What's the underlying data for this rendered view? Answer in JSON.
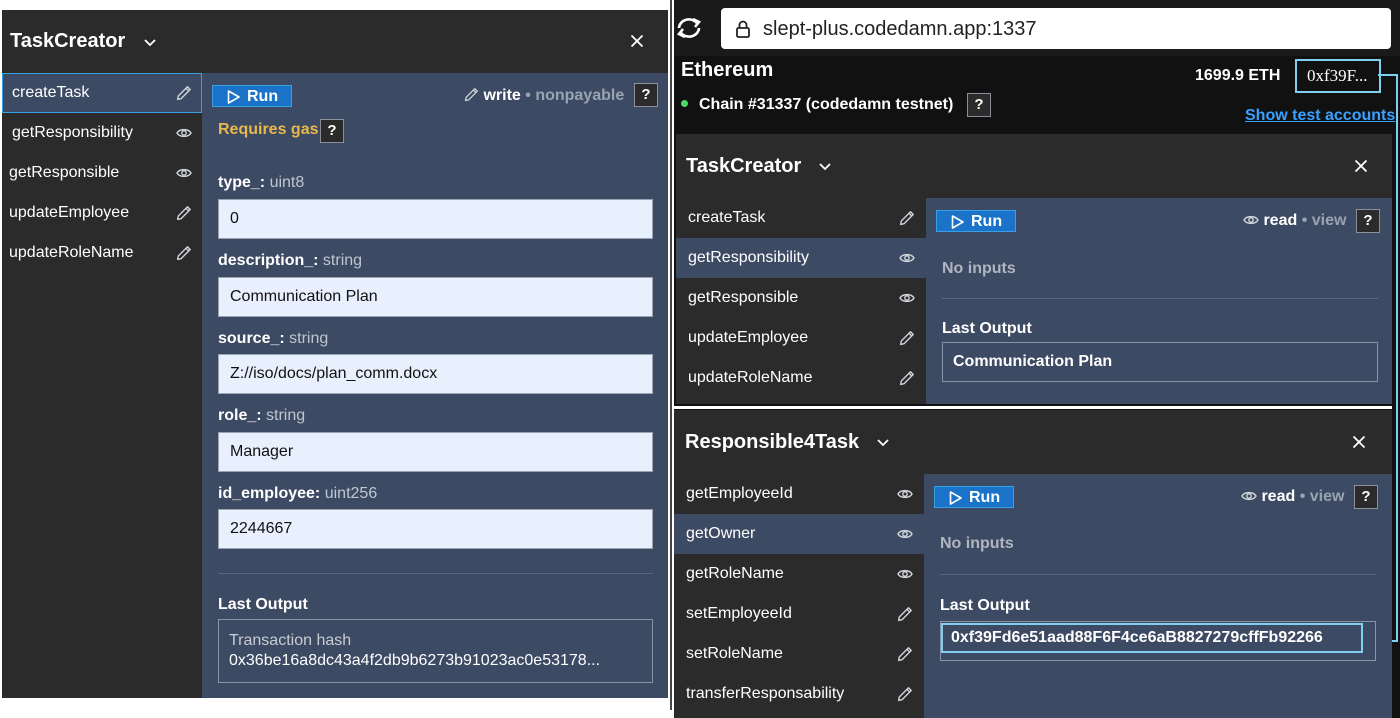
{
  "left_panel": {
    "title": "TaskCreator",
    "methods": [
      {
        "label": "createTask",
        "icon": "pencil-icon"
      },
      {
        "label": "getResponsibility",
        "icon": "eye-icon"
      },
      {
        "label": "getResponsible",
        "icon": "eye-icon"
      },
      {
        "label": "updateEmployee",
        "icon": "pencil-icon"
      },
      {
        "label": "updateRoleName",
        "icon": "pencil-icon"
      }
    ],
    "run_label": "Run",
    "mode_label": "write",
    "mode_sep": "•",
    "mode_kind": "nonpayable",
    "help_label": "?",
    "requires_gas": "Requires gas",
    "fields": [
      {
        "name": "type_:",
        "type": "uint8",
        "value": "0"
      },
      {
        "name": "description_:",
        "type": "string",
        "value": "Communication Plan"
      },
      {
        "name": "source_:",
        "type": "string",
        "value": "Z://iso/docs/plan_comm.docx"
      },
      {
        "name": "role_:",
        "type": "string",
        "value": "Manager"
      },
      {
        "name": "id_employee:",
        "type": "uint256",
        "value": "2244667"
      }
    ],
    "last_output_label": "Last Output",
    "output_title": "Transaction hash",
    "output_value": "0x36be16a8dc43a4f2db9b6273b91023ac0e53178..."
  },
  "browser": {
    "url": "slept-plus.codedamn.app:1337"
  },
  "network": {
    "name": "Ethereum",
    "balance": "1699.9 ETH",
    "account": "0xf39F...",
    "chain": "Chain #31337 (codedamn testnet)",
    "help_label": "?",
    "show_accounts": "Show test accounts",
    "status_color": "#4cd964"
  },
  "right_top_panel": {
    "title": "TaskCreator",
    "methods": [
      {
        "label": "createTask",
        "icon": "pencil-icon"
      },
      {
        "label": "getResponsibility",
        "icon": "eye-icon"
      },
      {
        "label": "getResponsible",
        "icon": "eye-icon"
      },
      {
        "label": "updateEmployee",
        "icon": "pencil-icon"
      },
      {
        "label": "updateRoleName",
        "icon": "pencil-icon"
      }
    ],
    "run_label": "Run",
    "mode_label": "read",
    "mode_sep": "•",
    "mode_kind": "view",
    "help_label": "?",
    "no_inputs": "No inputs",
    "last_output_label": "Last Output",
    "output_value": "Communication Plan"
  },
  "right_bottom_panel": {
    "title": "Responsible4Task",
    "methods": [
      {
        "label": "getEmployeeId",
        "icon": "eye-icon"
      },
      {
        "label": "getOwner",
        "icon": "eye-icon"
      },
      {
        "label": "getRoleName",
        "icon": "eye-icon"
      },
      {
        "label": "setEmployeeId",
        "icon": "pencil-icon"
      },
      {
        "label": "setRoleName",
        "icon": "pencil-icon"
      },
      {
        "label": "transferResponsability",
        "icon": "pencil-icon"
      }
    ],
    "run_label": "Run",
    "mode_label": "read",
    "mode_sep": "•",
    "mode_kind": "view",
    "help_label": "?",
    "no_inputs": "No inputs",
    "last_output_label": "Last Output",
    "output_value": "0xf39Fd6e51aad88F6F4ce6aB8827279cffFb92266"
  },
  "colors": {
    "panel_bg": "#2b2b2b",
    "content_bg": "#3d4a63",
    "run_blue": "#1a73c9",
    "highlight_cyan": "#7fd0f0",
    "gas_yellow": "#e8b84a",
    "link_blue": "#3aa0ff"
  }
}
